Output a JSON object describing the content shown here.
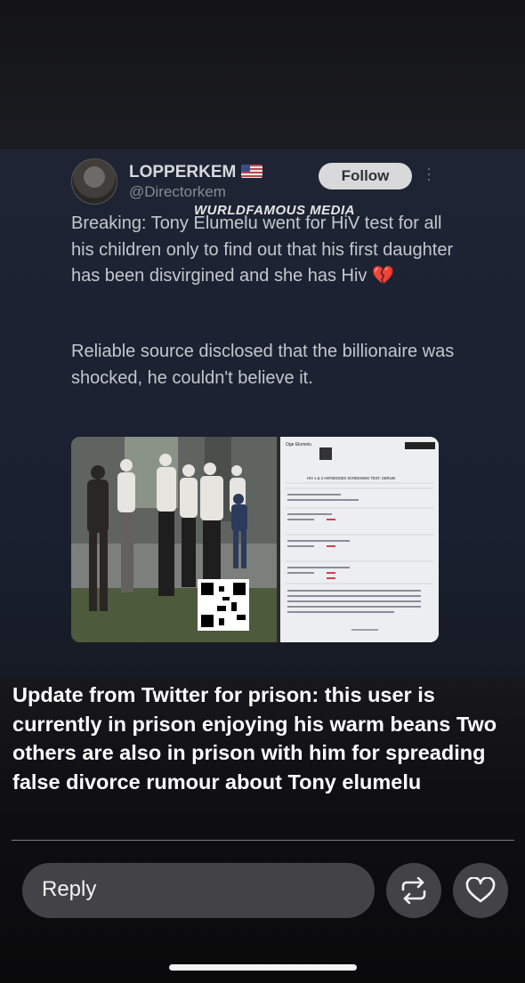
{
  "tweet": {
    "display_name": "LOPPERKEM",
    "handle": "@Directorkem",
    "follow_label": "Follow",
    "watermark": "WURLDFAMOUS MEDIA",
    "text_paragraph_1": "Breaking: Tony Elumelu went for HiV test for all his children only to find out that his first daughter has been disvirgined and she has Hiv",
    "text_paragraph_2": "Reliable source disclosed that the billionaire was shocked, he couldn't believe it.",
    "emoji_icon": "broken-heart-icon",
    "flag_icon": "us-flag-icon",
    "document_header": "HIV 1 & 2 ANTIBODIES SCREENING TEST, SERUM",
    "document_name": "Oge Elumelu"
  },
  "story": {
    "caption": "Update from Twitter for prison: this user is currently in prison enjoying his warm beans Two others are also in prison with him for spreading false divorce rumour about Tony elumelu",
    "reply_placeholder": "Reply",
    "repost_icon": "repost-icon",
    "like_icon": "heart-icon"
  },
  "colors": {
    "card_bg": "#1e2433",
    "follow_bg": "#d9d9db",
    "control_bg": "#434347"
  }
}
